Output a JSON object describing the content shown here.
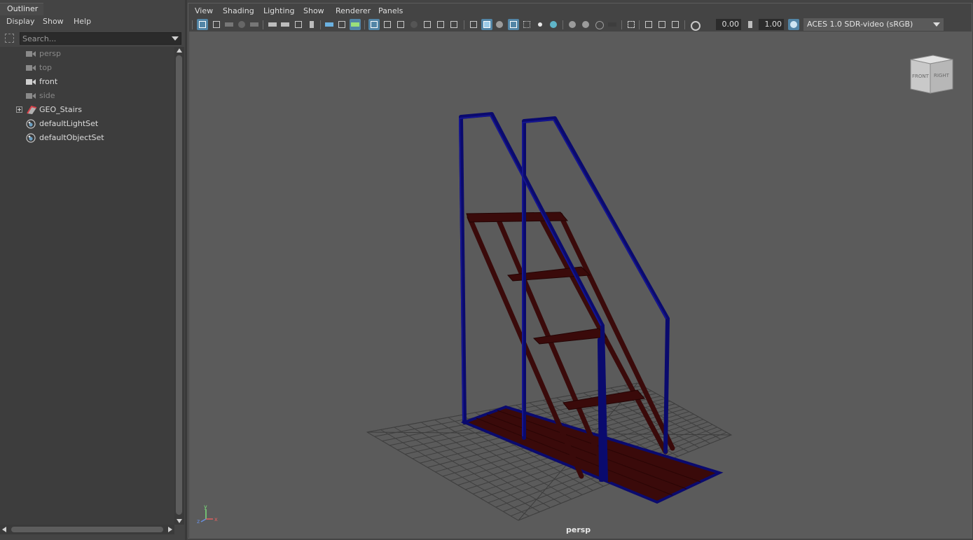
{
  "outliner": {
    "title": "Outliner",
    "menu": [
      "Display",
      "Show",
      "Help"
    ],
    "search_placeholder": "Search...",
    "items": [
      {
        "label": "persp",
        "icon": "camera-icon",
        "dim": true
      },
      {
        "label": "top",
        "icon": "camera-icon",
        "dim": true
      },
      {
        "label": "front",
        "icon": "camera-icon",
        "dim": false
      },
      {
        "label": "side",
        "icon": "camera-icon",
        "dim": true
      },
      {
        "label": "GEO_Stairs",
        "icon": "mesh-group-icon",
        "dim": false,
        "expandable": true
      },
      {
        "label": "defaultLightSet",
        "icon": "set-icon",
        "dim": false
      },
      {
        "label": "defaultObjectSet",
        "icon": "set-icon",
        "dim": false
      }
    ]
  },
  "viewport": {
    "menu": [
      "View",
      "Shading",
      "Lighting",
      "Show",
      "Renderer",
      "Panels"
    ],
    "exposure": "0.00",
    "gamma": "1.00",
    "color_space": "ACES 1.0 SDR-video (sRGB)",
    "camera_label": "persp",
    "viewcube": {
      "front": "FRONT",
      "right": "RIGHT"
    },
    "axis": {
      "x": "x",
      "y": "y",
      "z": "z"
    },
    "colors": {
      "background": "#5b5b5b",
      "grid": "#3f3f3f",
      "stringer": "#3a0a0a",
      "rail": "#0a0a6e",
      "selected_accent": "#5285a6"
    }
  }
}
